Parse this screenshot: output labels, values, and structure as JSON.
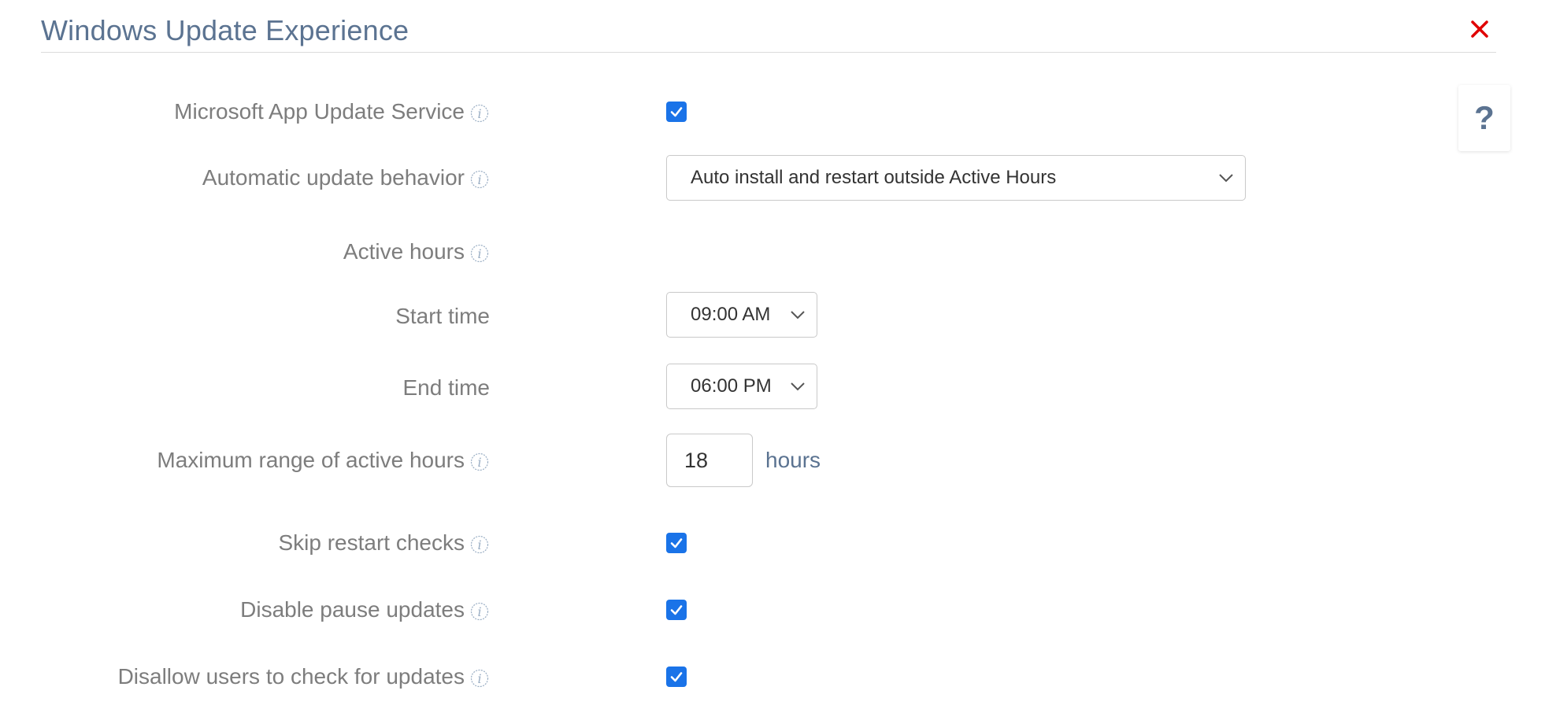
{
  "header": {
    "title": "Windows Update Experience",
    "close_icon": "close-icon",
    "close_color": "#e00000"
  },
  "help": {
    "label": "?"
  },
  "fields": {
    "microsoft_app_update": {
      "label": "Microsoft App Update Service",
      "checked": true
    },
    "automatic_update_behavior": {
      "label": "Automatic update behavior",
      "selected": "Auto install and restart outside Active Hours"
    },
    "active_hours": {
      "label": "Active hours"
    },
    "start_time": {
      "label": "Start time",
      "selected": "09:00 AM"
    },
    "end_time": {
      "label": "End time",
      "selected": "06:00 PM"
    },
    "max_range": {
      "label": "Maximum range of active hours",
      "value": "18",
      "unit": "hours"
    },
    "skip_restart_checks": {
      "label": "Skip restart checks",
      "checked": true
    },
    "disable_pause_updates": {
      "label": "Disable pause updates",
      "checked": true
    },
    "disallow_check_updates": {
      "label": "Disallow users to check for updates",
      "checked": true
    }
  },
  "colors": {
    "accent": "#1a73e8",
    "title": "#5b7391",
    "label": "#7d7d7d",
    "info_icon": "#9aaec4"
  }
}
